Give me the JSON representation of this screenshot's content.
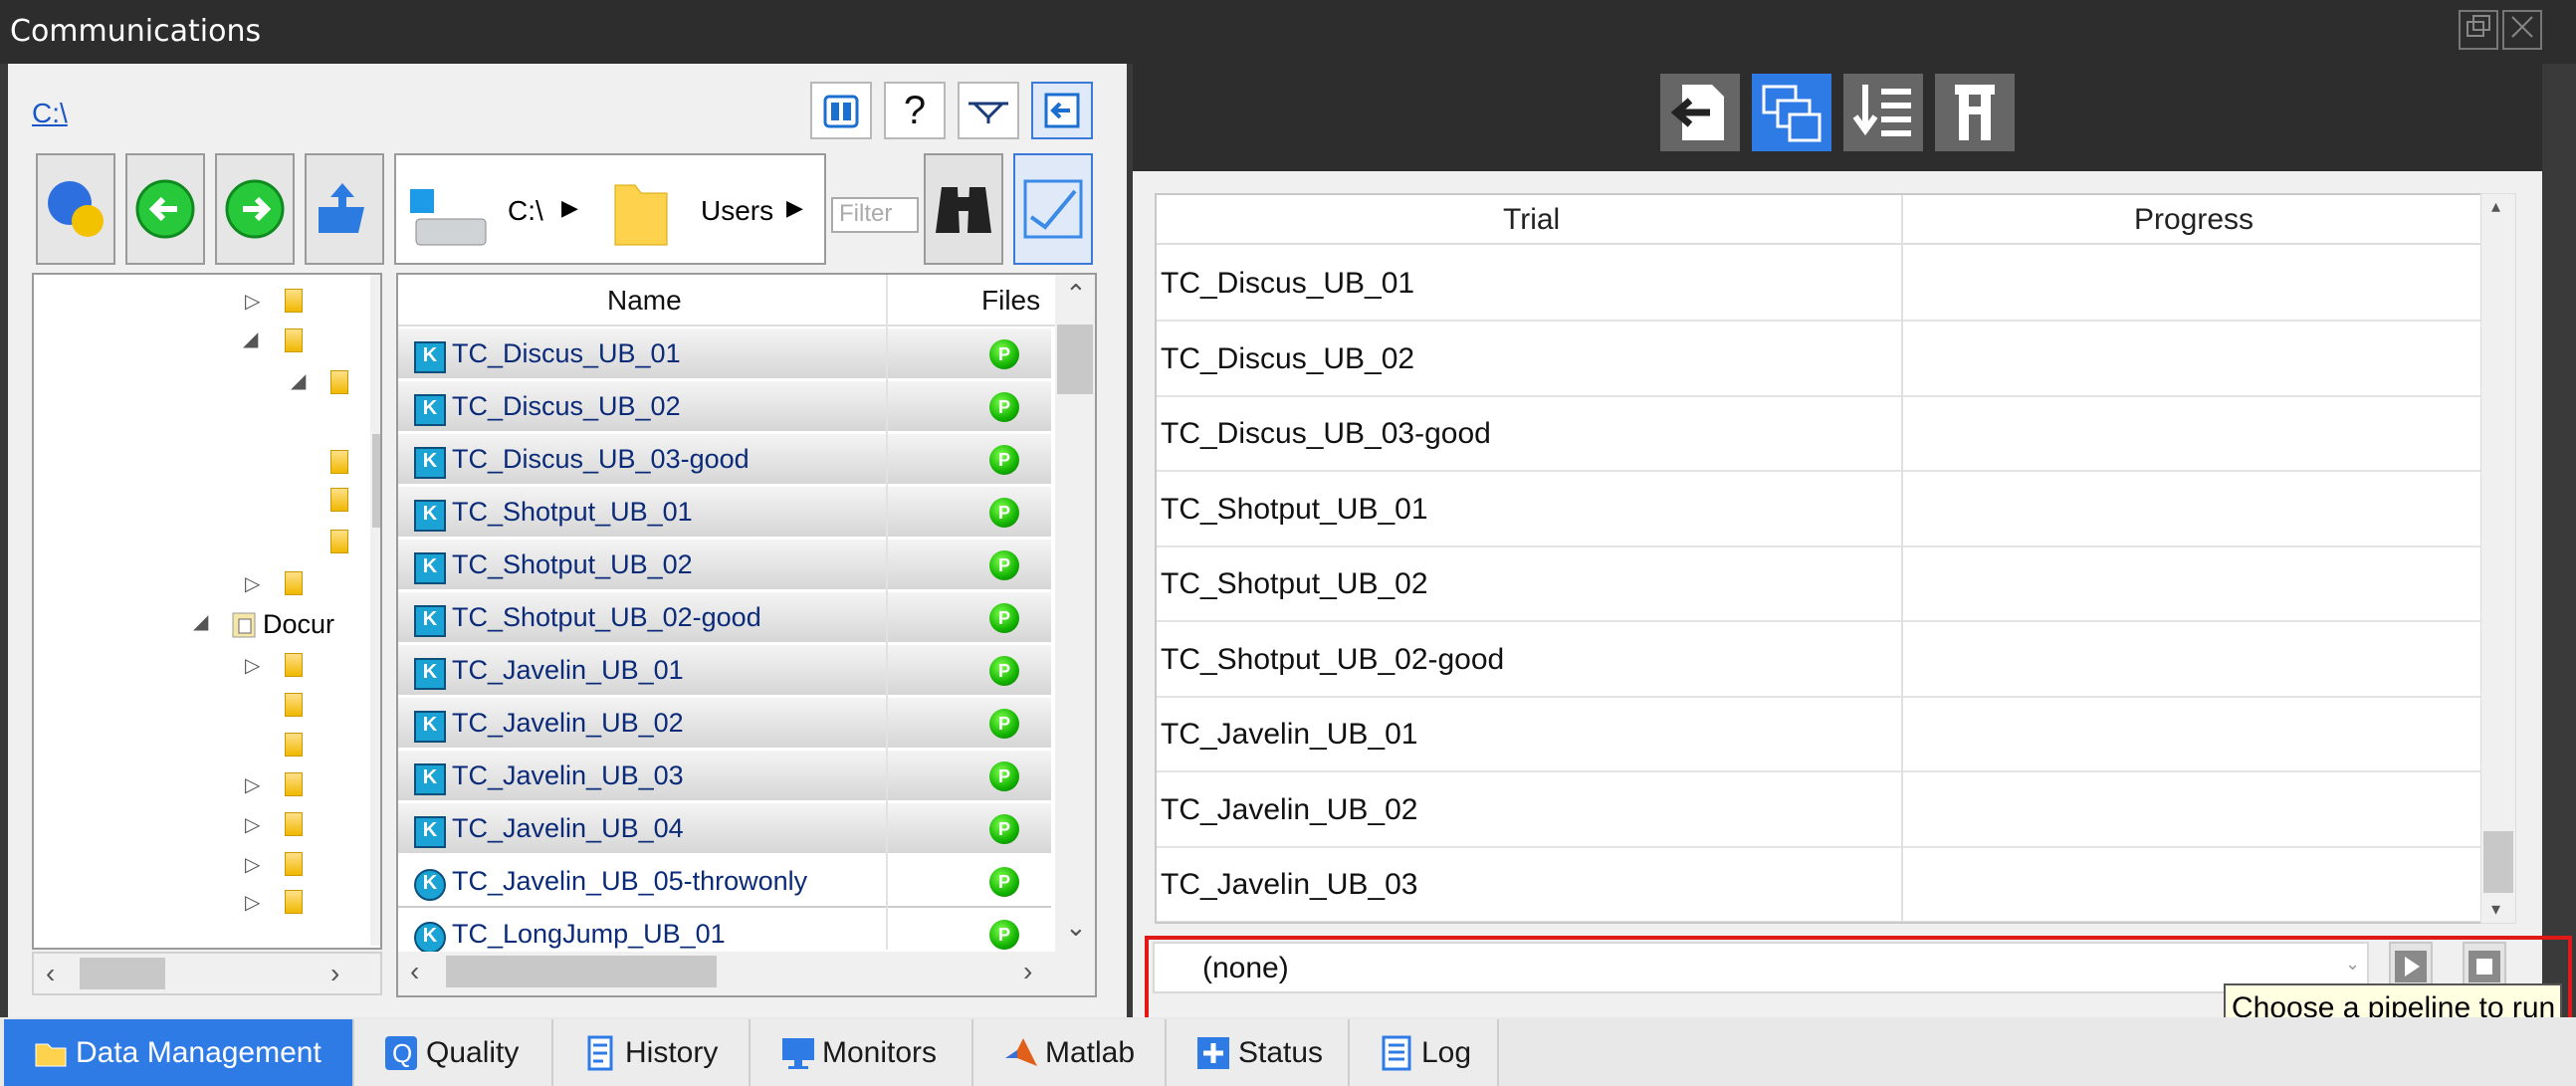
{
  "window": {
    "title": "Communications"
  },
  "location": {
    "path_link": "C:\\"
  },
  "breadcrumb": {
    "drive": "C:\\",
    "folder": "Users"
  },
  "filter": {
    "placeholder": "Filter"
  },
  "tree": {
    "documents_label": "Docur"
  },
  "file_list": {
    "columns": [
      "Name",
      "Files"
    ],
    "rows": [
      {
        "name": "TC_Discus_UB_01",
        "status": "P"
      },
      {
        "name": "TC_Discus_UB_02",
        "status": "P"
      },
      {
        "name": "TC_Discus_UB_03-good",
        "status": "P"
      },
      {
        "name": "TC_Shotput_UB_01",
        "status": "P"
      },
      {
        "name": "TC_Shotput_UB_02",
        "status": "P"
      },
      {
        "name": "TC_Shotput_UB_02-good",
        "status": "P"
      },
      {
        "name": "TC_Javelin_UB_01",
        "status": "P"
      },
      {
        "name": "TC_Javelin_UB_02",
        "status": "P"
      },
      {
        "name": "TC_Javelin_UB_03",
        "status": "P"
      },
      {
        "name": "TC_Javelin_UB_04",
        "status": "P"
      },
      {
        "name": "TC_Javelin_UB_05-throwonly",
        "status": "P"
      },
      {
        "name": "TC_LongJump_UB_01",
        "status": "P"
      }
    ]
  },
  "trial_table": {
    "columns": [
      "Trial",
      "Progress"
    ],
    "rows": [
      "TC_Discus_UB_01",
      "TC_Discus_UB_02",
      "TC_Discus_UB_03-good",
      "TC_Shotput_UB_01",
      "TC_Shotput_UB_02",
      "TC_Shotput_UB_02-good",
      "TC_Javelin_UB_01",
      "TC_Javelin_UB_02",
      "TC_Javelin_UB_03"
    ]
  },
  "pipeline": {
    "selected": "(none)",
    "tooltip": "Choose a pipeline to run"
  },
  "tabs": [
    "Data Management",
    "Quality",
    "History",
    "Monitors",
    "Matlab",
    "Status",
    "Log"
  ],
  "colors": {
    "accent": "#2f7be6",
    "highlight": "#e01818",
    "status_green": "#12b300"
  }
}
